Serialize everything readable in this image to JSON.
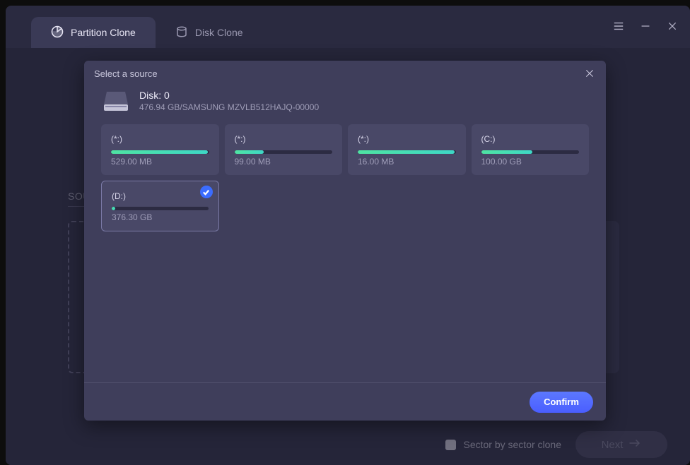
{
  "tabs": {
    "partition": "Partition Clone",
    "disk": "Disk Clone"
  },
  "background": {
    "section_label": "SOU",
    "next_label": "Next"
  },
  "footer": {
    "sector_label": "Sector by sector clone"
  },
  "modal": {
    "title": "Select a source",
    "disk": {
      "title": "Disk: 0",
      "subtitle": "476.94 GB/SAMSUNG MZVLB512HAJQ-00000"
    },
    "partitions": [
      {
        "label": "(*:)",
        "size": "529.00 MB",
        "fill_pct": 99
      },
      {
        "label": "(*:)",
        "size": "99.00 MB",
        "fill_pct": 30
      },
      {
        "label": "(*:)",
        "size": "16.00 MB",
        "fill_pct": 99
      },
      {
        "label": "(C:)",
        "size": "100.00 GB",
        "fill_pct": 52
      },
      {
        "label": "(D:)",
        "size": "376.30 GB",
        "fill_pct": 4,
        "selected": true
      }
    ],
    "confirm": "Confirm"
  },
  "colors": {
    "accent_blue": "#4a5eff",
    "accent_green_start": "#4fe3a2",
    "accent_green_end": "#3ed7c6"
  }
}
